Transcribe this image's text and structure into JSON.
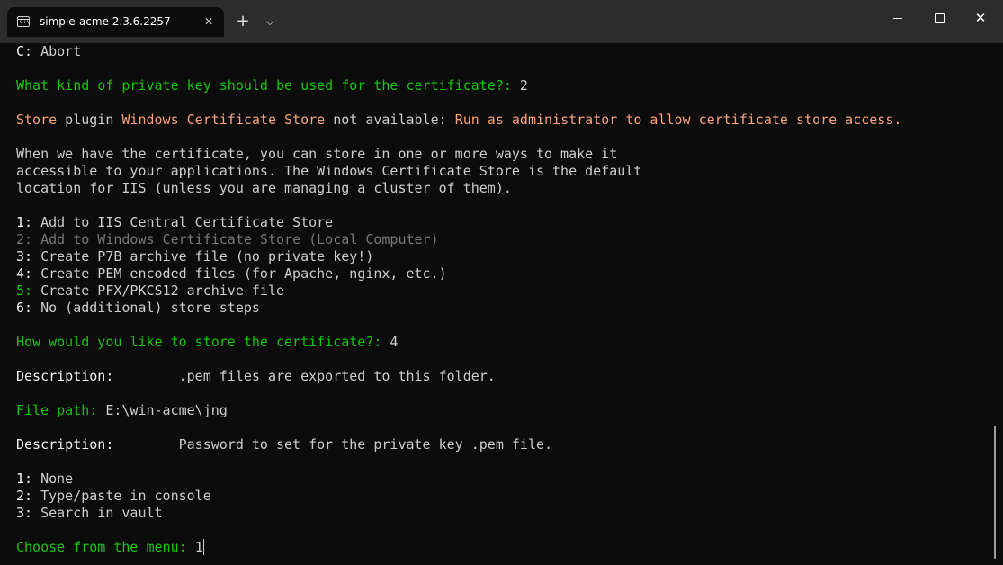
{
  "window": {
    "tab_title": "simple-acme 2.3.6.2257",
    "tab_icon_prompt": "C:\\",
    "tab_close_glyph": "✕",
    "new_tab_glyph": "+",
    "dropdown_glyph": "⌵",
    "close_glyph": "✕",
    "icons": {
      "tab": "terminal-icon",
      "tab_close": "close-icon",
      "new_tab": "plus-icon",
      "dropdown": "chevron-down-icon",
      "minimize": "minimize-icon",
      "maximize": "maximize-icon",
      "close": "close-icon"
    }
  },
  "colors": {
    "background": "#0c0c0c",
    "titlebar": "#2c2c2c",
    "text": "#cccccc",
    "prompt_green": "#16c60c",
    "warning_orange": "#f9a17b",
    "disabled_gray": "#767676"
  },
  "terminal": {
    "lines": [
      {
        "segments": [
          {
            "text": "C:",
            "style": "white"
          },
          {
            "text": " Abort",
            "style": "default"
          }
        ]
      },
      {
        "segments": []
      },
      {
        "segments": [
          {
            "text": "What kind of private key should be used for the certificate?: ",
            "style": "green"
          },
          {
            "text": "2",
            "style": "default"
          }
        ]
      },
      {
        "segments": []
      },
      {
        "segments": [
          {
            "text": "Store",
            "style": "orange"
          },
          {
            "text": " plugin ",
            "style": "default"
          },
          {
            "text": "Windows Certificate Store",
            "style": "orange"
          },
          {
            "text": " not available: ",
            "style": "default"
          },
          {
            "text": "Run as administrator to allow certificate store access.",
            "style": "orange"
          }
        ]
      },
      {
        "segments": []
      },
      {
        "segments": [
          {
            "text": "When we have the certificate, you can store in one or more ways to make it",
            "style": "default"
          }
        ]
      },
      {
        "segments": [
          {
            "text": "accessible to your applications. The Windows Certificate Store is the default",
            "style": "default"
          }
        ]
      },
      {
        "segments": [
          {
            "text": "location for IIS (unless you are managing a cluster of them).",
            "style": "default"
          }
        ]
      },
      {
        "segments": []
      },
      {
        "segments": [
          {
            "text": "1:",
            "style": "white"
          },
          {
            "text": " Add to IIS Central Certificate Store",
            "style": "default"
          }
        ]
      },
      {
        "segments": [
          {
            "text": "2: Add to Windows Certificate Store (Local Computer)",
            "style": "gray"
          }
        ]
      },
      {
        "segments": [
          {
            "text": "3:",
            "style": "white"
          },
          {
            "text": " Create P7B archive file (no private key!)",
            "style": "default"
          }
        ]
      },
      {
        "segments": [
          {
            "text": "4:",
            "style": "white"
          },
          {
            "text": " Create PEM encoded files (for Apache, nginx, etc.)",
            "style": "default"
          }
        ]
      },
      {
        "segments": [
          {
            "text": "5:",
            "style": "green"
          },
          {
            "text": " Create PFX/PKCS12 archive file",
            "style": "default"
          }
        ]
      },
      {
        "segments": [
          {
            "text": "6:",
            "style": "white"
          },
          {
            "text": " No (additional) store steps",
            "style": "default"
          }
        ]
      },
      {
        "segments": []
      },
      {
        "segments": [
          {
            "text": "How would you like to store the certificate?: ",
            "style": "green"
          },
          {
            "text": "4",
            "style": "default"
          }
        ]
      },
      {
        "segments": []
      },
      {
        "segments": [
          {
            "text": "Description:",
            "style": "white"
          },
          {
            "text": "        .pem files are exported to this folder.",
            "style": "default"
          }
        ]
      },
      {
        "segments": []
      },
      {
        "segments": [
          {
            "text": "File path: ",
            "style": "green"
          },
          {
            "text": "E:\\win-acme\\jng",
            "style": "default"
          }
        ]
      },
      {
        "segments": []
      },
      {
        "segments": [
          {
            "text": "Description:",
            "style": "white"
          },
          {
            "text": "        Password to set for the private key .pem file.",
            "style": "default"
          }
        ]
      },
      {
        "segments": []
      },
      {
        "segments": [
          {
            "text": "1:",
            "style": "white"
          },
          {
            "text": " None",
            "style": "default"
          }
        ]
      },
      {
        "segments": [
          {
            "text": "2:",
            "style": "white"
          },
          {
            "text": " Type/paste in console",
            "style": "default"
          }
        ]
      },
      {
        "segments": [
          {
            "text": "3:",
            "style": "white"
          },
          {
            "text": " Search in vault",
            "style": "default"
          }
        ]
      },
      {
        "segments": []
      },
      {
        "segments": [
          {
            "text": "Choose from the menu: ",
            "style": "green"
          },
          {
            "text": "1",
            "style": "default"
          }
        ],
        "cursor": true
      }
    ]
  }
}
